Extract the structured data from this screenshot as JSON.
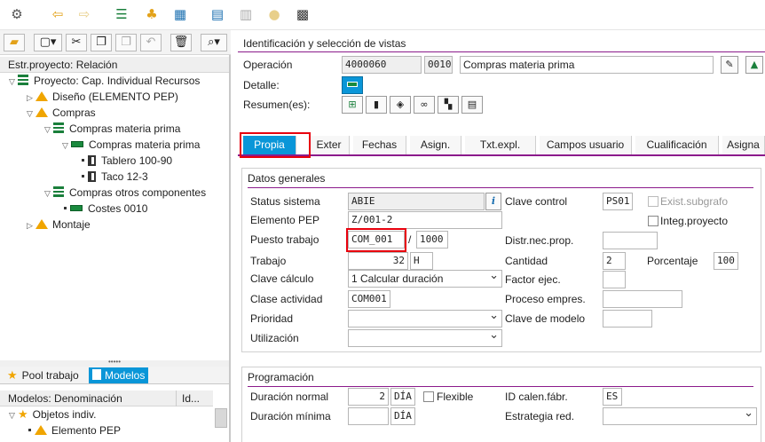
{
  "toolbar": {
    "icons": [
      "display-change-icon",
      "back-arrow-icon",
      "forward-arrow-icon",
      "hierarchy-icon",
      "structure-icon",
      "network-icon",
      "grid-icon",
      "delete-icon",
      "note-icon",
      "filter-icon"
    ]
  },
  "left_panel": {
    "header": "Estr.proyecto: Relación",
    "tree": [
      {
        "label": "Proyecto: Cap. Individual Recursos",
        "icon": "project-icon",
        "level": 0,
        "expanded": true
      },
      {
        "label": "Diseño (ELEMENTO PEP)",
        "icon": "wbs-element-icon",
        "level": 1,
        "expanded": false
      },
      {
        "label": "Compras",
        "icon": "wbs-element-icon",
        "level": 1,
        "expanded": true
      },
      {
        "label": "Compras materia prima",
        "icon": "network-icon",
        "level": 2,
        "expanded": true
      },
      {
        "label": "Compras materia prima",
        "icon": "activity-icon",
        "level": 3,
        "expanded": true
      },
      {
        "label": "Tablero 100-90",
        "icon": "component-icon",
        "level": 4
      },
      {
        "label": "Taco 12-3",
        "icon": "component-icon",
        "level": 4
      },
      {
        "label": "Compras otros componentes",
        "icon": "network-icon",
        "level": 2,
        "expanded": true
      },
      {
        "label": "Costes 0010",
        "icon": "activity-icon",
        "level": 3
      },
      {
        "label": "Montaje",
        "icon": "wbs-element-icon",
        "level": 1,
        "expanded": false
      }
    ],
    "model_tabs": {
      "pool": "Pool trabajo",
      "models": "Modelos"
    },
    "models_header": {
      "col1": "Modelos: Denominación",
      "col2": "Id..."
    },
    "models_tree": [
      {
        "label": "Objetos indiv.",
        "level": 0
      },
      {
        "label": "Elemento PEP",
        "level": 1
      }
    ]
  },
  "right_panel": {
    "section_title": "Identificación y selección de vistas",
    "operacion": {
      "label": "Operación",
      "number": "4000060",
      "activity": "0010",
      "description": "Compras materia prima"
    },
    "detalle": {
      "label": "Detalle:"
    },
    "resumen": {
      "label": "Resumen(es):"
    },
    "tabs": [
      "Propia",
      "Exter",
      "Fechas",
      "Asign.",
      "Txt.expl.",
      "Campos usuario",
      "Cualificación",
      "Asigna"
    ],
    "active_tab": "Propia",
    "datos_generales": {
      "title": "Datos generales",
      "status_sistema": {
        "label": "Status sistema",
        "value": "ABIE"
      },
      "elemento_pep": {
        "label": "Elemento PEP",
        "value": "Z/001-2"
      },
      "puesto_trabajo": {
        "label": "Puesto trabajo",
        "value": "COM_001",
        "separator": "/",
        "centro": "1000"
      },
      "trabajo": {
        "label": "Trabajo",
        "value": "32",
        "unit": "H"
      },
      "clave_calculo": {
        "label": "Clave cálculo",
        "value": "1 Calcular duración"
      },
      "clase_actividad": {
        "label": "Clase actividad",
        "value": "COM001"
      },
      "prioridad": {
        "label": "Prioridad",
        "value": ""
      },
      "utilizacion": {
        "label": "Utilización",
        "value": ""
      },
      "clave_control": {
        "label": "Clave control",
        "value": "PS01"
      },
      "exist_subgrafo": {
        "label": "Exist.subgrafo",
        "checked": false
      },
      "integ_proyecto": {
        "label": "Integ.proyecto",
        "checked": false
      },
      "distr_nec_prop": {
        "label": "Distr.nec.prop.",
        "value": ""
      },
      "cantidad": {
        "label": "Cantidad",
        "value": "2"
      },
      "porcentaje": {
        "label": "Porcentaje",
        "value": "100"
      },
      "factor_ejec": {
        "label": "Factor ejec.",
        "value": ""
      },
      "proceso_empres": {
        "label": "Proceso empres.",
        "value": ""
      },
      "clave_modelo": {
        "label": "Clave de modelo",
        "value": ""
      }
    },
    "programacion": {
      "title": "Programación",
      "duracion_normal": {
        "label": "Duración normal",
        "value": "2",
        "unit": "DÍA"
      },
      "flexible": {
        "label": "Flexible",
        "checked": false
      },
      "duracion_minima": {
        "label": "Duración mínima",
        "value": "",
        "unit": "DÍA"
      },
      "id_calen": {
        "label": "ID calen.fábr.",
        "value": "ES"
      },
      "estrategia": {
        "label": "Estrategia red.",
        "value": ""
      }
    }
  },
  "colors": {
    "accent": "#0a96d8",
    "section_line": "#8b1a8b",
    "highlight": "#e8000d",
    "wbs": "#f0a500",
    "network": "#1a7f3b"
  }
}
